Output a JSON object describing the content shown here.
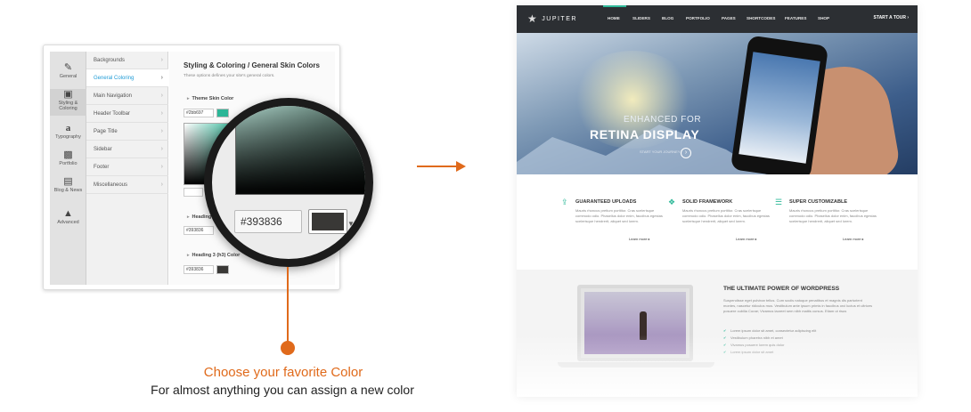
{
  "colors": {
    "accent": "#e06a1b",
    "teal": "#2fb999",
    "nav_bg": "#2c2f33",
    "selected_color": "#393836"
  },
  "admin": {
    "icon_tabs": [
      {
        "label": "General",
        "icon": "brush-icon"
      },
      {
        "label": "Styling & Coloring",
        "icon": "palette-icon"
      },
      {
        "label": "Typography",
        "icon": "font-icon"
      },
      {
        "label": "Portfolio",
        "icon": "briefcase-icon"
      },
      {
        "label": "Blog & News",
        "icon": "newspaper-icon"
      },
      {
        "label": "Advanced",
        "icon": "wrench-icon"
      }
    ],
    "menu": [
      {
        "label": "Backgrounds"
      },
      {
        "label": "General Coloring"
      },
      {
        "label": "Main Navigation"
      },
      {
        "label": "Header Toolbar"
      },
      {
        "label": "Page Title"
      },
      {
        "label": "Sidebar"
      },
      {
        "label": "Footer"
      },
      {
        "label": "Miscellaneous"
      }
    ],
    "content": {
      "title": "Styling & Coloring / General Skin Colors",
      "subtitle": "These options defines your site's general colors.",
      "theme_skin_label": "Theme Skin Color",
      "theme_skin_value": "#2bb697",
      "heading_label": "Heading",
      "heading_value": "#393836",
      "heading3_label": "Heading 3 (h3) Color",
      "heading3_value": "#393836"
    },
    "magnifier": {
      "hex_value": "#393836"
    }
  },
  "caption": {
    "title": "Choose your favorite Color",
    "subtitle": "For almost anything you can assign a new color"
  },
  "site": {
    "logo": "JUPITER",
    "nav": [
      "HOME",
      "SLIDERS",
      "BLOG",
      "PORTFOLIO",
      "PAGES",
      "SHORTCODES",
      "FEATURES",
      "SHOP"
    ],
    "tour": "START A TOUR",
    "hero": {
      "kicker": "ENHANCED FOR",
      "title": "RETINA DISPLAY",
      "cta": "START YOUR JOURNEY"
    },
    "features": [
      {
        "title": "GUARANTEED UPLOADS",
        "icon": "upload-icon",
        "text": "Mauris rhoncus pretium porttitor. Cras scelerisque commodo odio. Phasellus dolor enim, faucibus egestas scelerisque hendrerit, aliquet sed lorem.",
        "more": "Learn more"
      },
      {
        "title": "SOLID FRAMEWORK",
        "icon": "cube-icon",
        "text": "Mauris rhoncus pretium porttitor. Cras scelerisque commodo odio. Phasellus dolor enim, faucibus egestas scelerisque hendrerit, aliquet sed lorem.",
        "more": "Learn more"
      },
      {
        "title": "SUPER CUSTOMIZABLE",
        "icon": "layers-icon",
        "text": "Mauris rhoncus pretium porttitor. Cras scelerisque commodo odio. Phasellus dolor enim, faucibus egestas scelerisque hendrerit, aliquet sed lorem.",
        "more": "Learn more"
      }
    ],
    "wordpress": {
      "title": "THE ULTIMATE POWER OF WORDPRESS",
      "text": "Suspendisse eget pulvinar tellus. Cum sociis natoque penatibus et magnis dis parturient montes, nascetur ridiculus mus. Vestibulum ante ipsum primis in faucibus orci luctus et ultrices posuere cubilia Curae; Vivamus laoreet sem nibh mattis cursus. Etiam ut risus",
      "list": [
        "Lorem ipsum dolor sit amet, consectetur adipiscing elit",
        "Vestibulum pharetra nibh et amet",
        "Vivamus posuere lorem quis dolor",
        "Lorem ipsum dolor sit amet"
      ]
    }
  }
}
